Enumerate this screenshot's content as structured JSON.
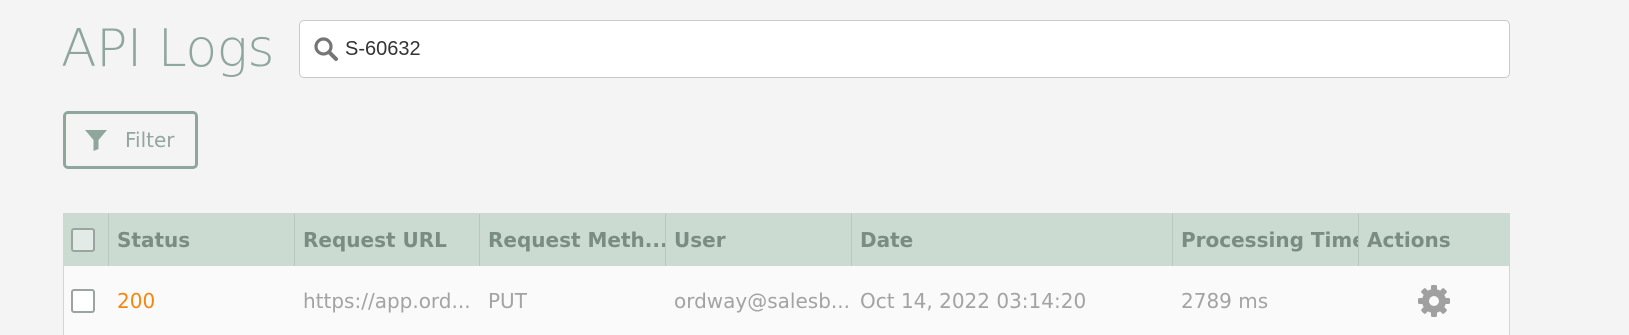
{
  "page": {
    "title": "API Logs"
  },
  "search": {
    "value": "S-60632",
    "icon": "search-icon"
  },
  "filter": {
    "label": "Filter",
    "icon": "filter-icon"
  },
  "table": {
    "columns": [
      "Status",
      "Request URL",
      "Request Meth...",
      "User",
      "Date",
      "Processing Time",
      "Actions"
    ],
    "rows": [
      {
        "status": "200",
        "request_url": "https://app.ord...",
        "request_method": "PUT",
        "user": "ordway@salesb...",
        "date": "Oct 14, 2022 03:14:20",
        "processing_time": "2789 ms",
        "actions_icon": "gear-icon"
      }
    ]
  },
  "colors": {
    "title": "#8fa69d",
    "header_bg": "#ccdbd1",
    "status_success": "#f5870f",
    "accent": "#8fa69d"
  }
}
